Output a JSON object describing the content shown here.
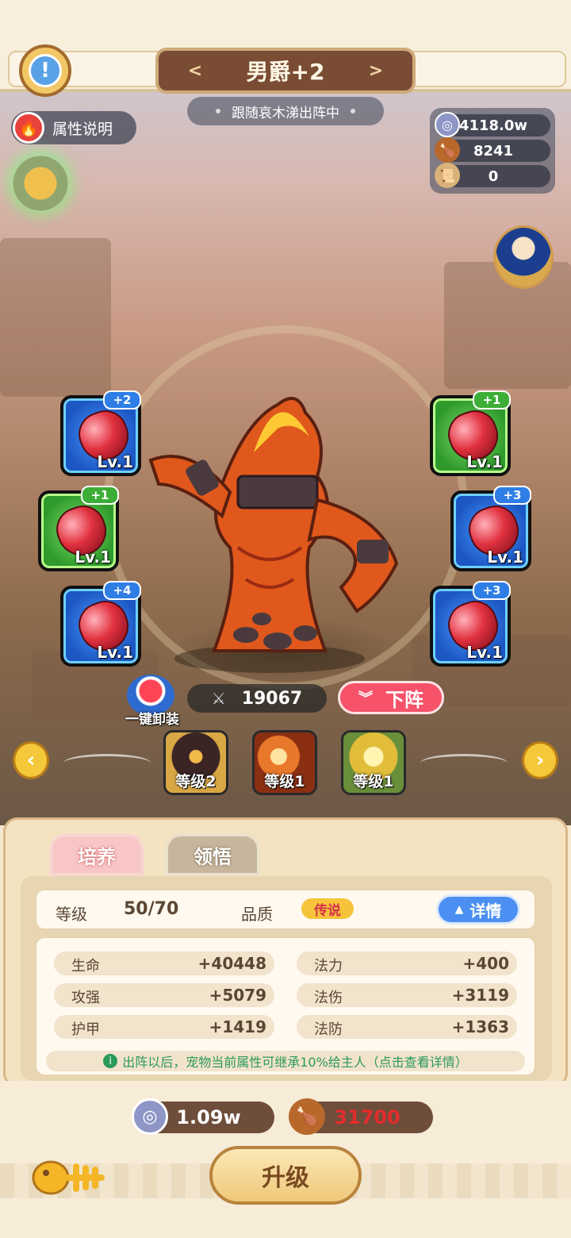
{
  "header": {
    "title": "男爵+2",
    "subtitle": "跟随哀木涕出阵中"
  },
  "attribute_button": {
    "label": "属性说明"
  },
  "resources": [
    {
      "icon": "silver-coin-icon",
      "value": "4118.0w"
    },
    {
      "icon": "drumstick-icon",
      "value": "8241"
    },
    {
      "icon": "scroll-icon",
      "value": "0"
    }
  ],
  "runes": [
    {
      "level": "Lv.1",
      "bonus": "+2",
      "color": "blue"
    },
    {
      "level": "Lv.1",
      "bonus": "+1",
      "color": "green"
    },
    {
      "level": "Lv.1",
      "bonus": "+4",
      "color": "blue"
    },
    {
      "level": "Lv.1",
      "bonus": "+1",
      "color": "green"
    },
    {
      "level": "Lv.1",
      "bonus": "+3",
      "color": "blue"
    },
    {
      "level": "Lv.1",
      "bonus": "+3",
      "color": "blue"
    }
  ],
  "unequip": {
    "label": "一键卸装"
  },
  "combat_power": "19067",
  "dismiss_button": {
    "label": "下阵"
  },
  "skills": [
    {
      "icon": "dark-shield-skill-icon",
      "label": "等级2"
    },
    {
      "icon": "fire-meteor-skill-icon",
      "label": "等级1"
    },
    {
      "icon": "gold-shield-skill-icon",
      "label": "等级1"
    }
  ],
  "tabs": [
    {
      "label": "培养",
      "active": true
    },
    {
      "label": "领悟",
      "active": false
    }
  ],
  "level": {
    "label": "等级",
    "value": "50/70"
  },
  "quality": {
    "label": "品质",
    "value": "传说"
  },
  "details_button": {
    "label": "详情"
  },
  "stats": [
    {
      "name": "生命",
      "value": "+40448"
    },
    {
      "name": "法力",
      "value": "+400"
    },
    {
      "name": "攻强",
      "value": "+5079"
    },
    {
      "name": "法伤",
      "value": "+3119"
    },
    {
      "name": "护甲",
      "value": "+1419"
    },
    {
      "name": "法防",
      "value": "+1363"
    }
  ],
  "tip": "出阵以后，宠物当前属性可继承10%给主人（点击查看详情）",
  "costs": [
    {
      "icon": "silver-coin-icon",
      "value": "1.09w",
      "color": "#ffffff"
    },
    {
      "icon": "drumstick-icon",
      "value": "31700",
      "color": "#e32c2c"
    }
  ],
  "upgrade_button": {
    "label": "升级"
  },
  "colors": {
    "accent": "#f6536a",
    "panel": "#f4e3c0",
    "button_blue": "#4a8ff1"
  }
}
